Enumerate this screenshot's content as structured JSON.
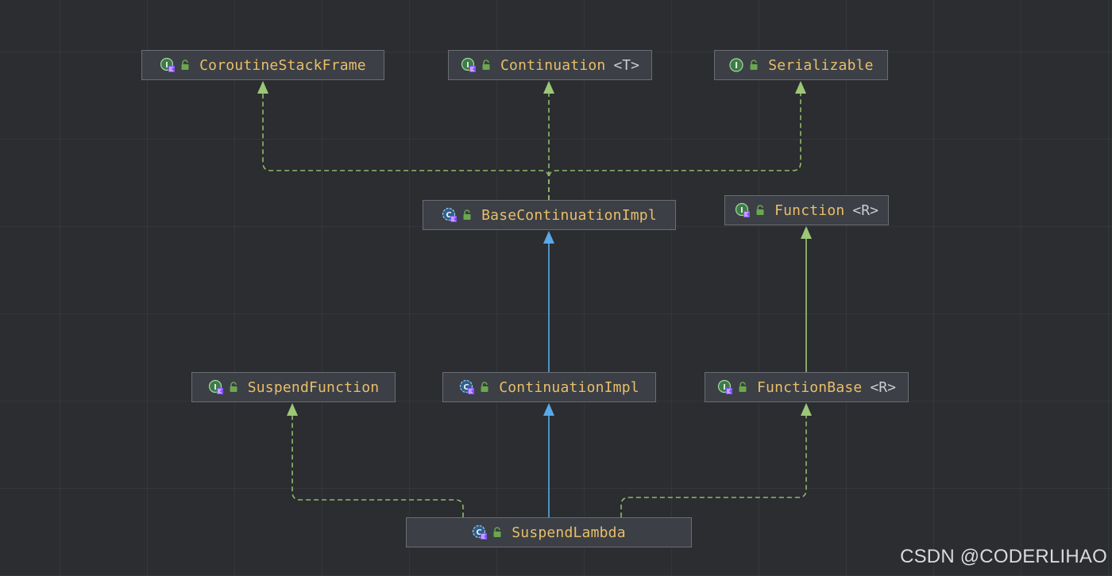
{
  "diagram": {
    "nodes": [
      {
        "id": "coroutine-stack-frame",
        "name": "CoroutineStackFrame",
        "type_param": "",
        "kind": "kotlin-interface"
      },
      {
        "id": "continuation",
        "name": "Continuation",
        "type_param": "<T>",
        "kind": "kotlin-interface"
      },
      {
        "id": "serializable",
        "name": "Serializable",
        "type_param": "",
        "kind": "interface"
      },
      {
        "id": "base-continuation-impl",
        "name": "BaseContinuationImpl",
        "type_param": "",
        "kind": "kotlin-abstract-class"
      },
      {
        "id": "function",
        "name": "Function",
        "type_param": "<R>",
        "kind": "kotlin-interface"
      },
      {
        "id": "suspend-function",
        "name": "SuspendFunction",
        "type_param": "",
        "kind": "kotlin-interface"
      },
      {
        "id": "continuation-impl",
        "name": "ContinuationImpl",
        "type_param": "",
        "kind": "kotlin-abstract-class"
      },
      {
        "id": "function-base",
        "name": "FunctionBase",
        "type_param": "<R>",
        "kind": "kotlin-interface"
      },
      {
        "id": "suspend-lambda",
        "name": "SuspendLambda",
        "type_param": "",
        "kind": "kotlin-abstract-class"
      }
    ],
    "edges": [
      {
        "from": "base-continuation-impl",
        "to": "coroutine-stack-frame",
        "relation": "implements"
      },
      {
        "from": "base-continuation-impl",
        "to": "continuation",
        "relation": "implements"
      },
      {
        "from": "base-continuation-impl",
        "to": "serializable",
        "relation": "implements"
      },
      {
        "from": "continuation-impl",
        "to": "base-continuation-impl",
        "relation": "extends"
      },
      {
        "from": "function-base",
        "to": "function",
        "relation": "extends"
      },
      {
        "from": "suspend-lambda",
        "to": "continuation-impl",
        "relation": "extends"
      },
      {
        "from": "suspend-lambda",
        "to": "suspend-function",
        "relation": "implements"
      },
      {
        "from": "suspend-lambda",
        "to": "function-base",
        "relation": "implements"
      }
    ]
  },
  "colors": {
    "background": "#2b2d30",
    "node_fill": "#3c3f45",
    "node_border": "#6a6d73",
    "class_name": "#e8bf6a",
    "type_param": "#c9ccd1",
    "extends_edge": "#5aa8e8",
    "implements_edge": "#8fba6a",
    "interface_extends_edge": "#9cc776"
  },
  "icons": {
    "kotlin-interface": "interface-icon",
    "interface": "interface-icon",
    "kotlin-abstract-class": "abstract-class-icon",
    "visibility": "public-lock-icon"
  },
  "watermark": "CSDN @CODERLIHAO"
}
